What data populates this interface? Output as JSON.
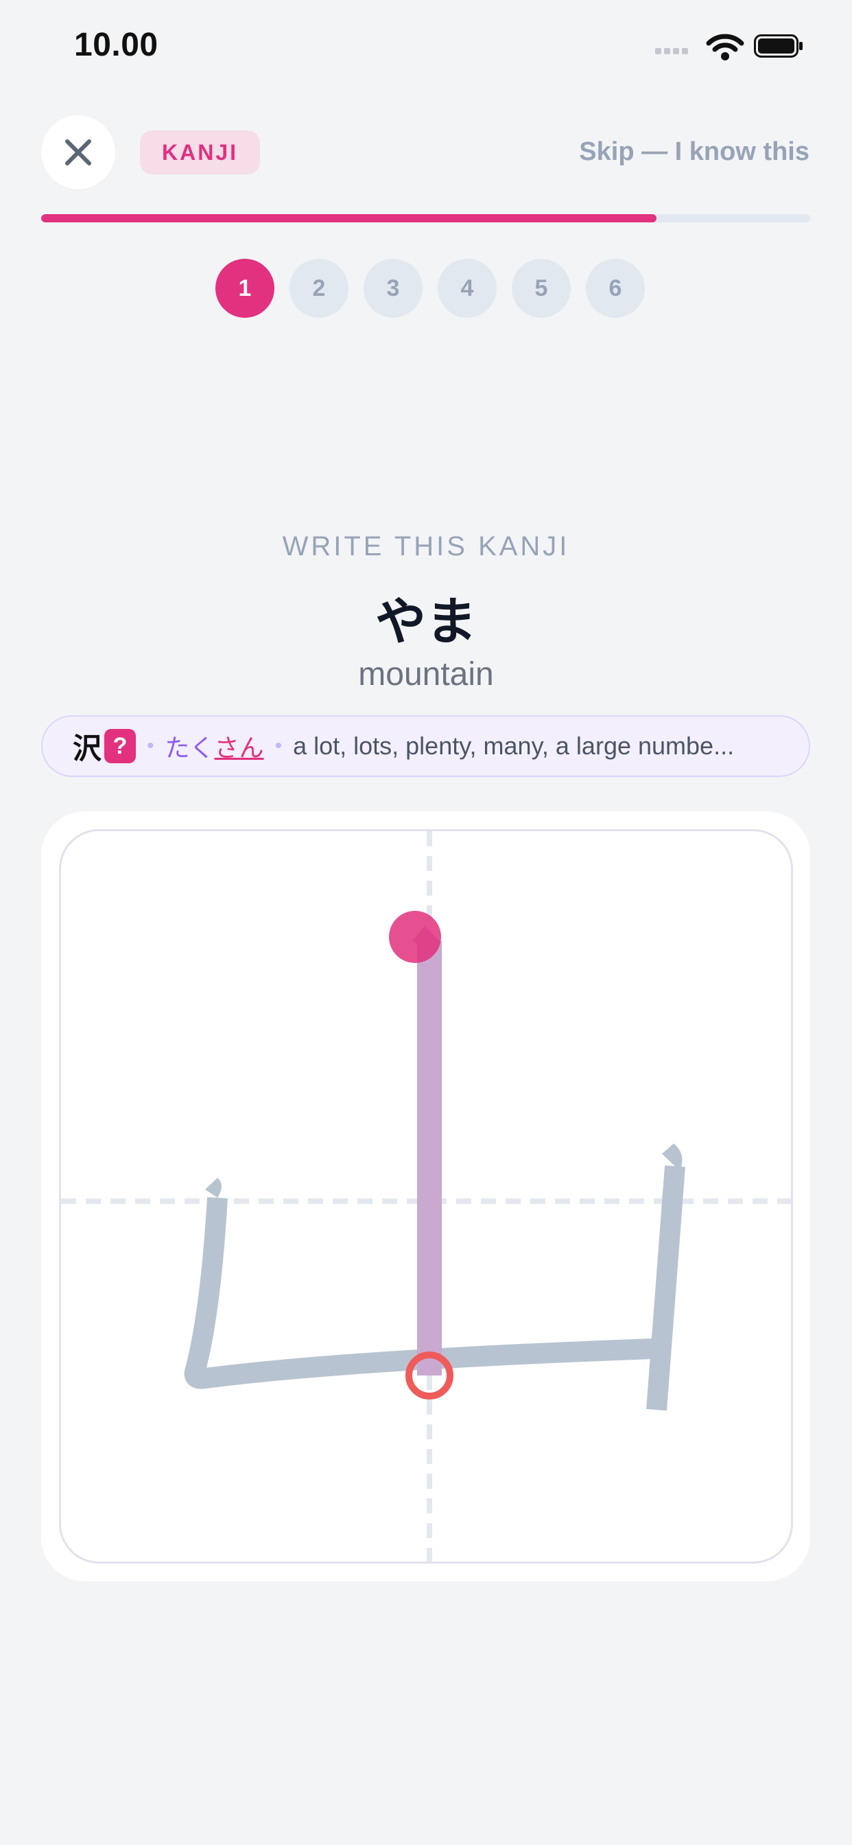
{
  "status_bar": {
    "time": "10.00"
  },
  "header": {
    "badge": "KANJI",
    "skip_label": "Skip — I know this",
    "progress": 0.8
  },
  "steps": [
    "1",
    "2",
    "3",
    "4",
    "5",
    "6"
  ],
  "active_step": 1,
  "prompt": {
    "label": "WRITE THIS KANJI",
    "kana": "やま",
    "meaning": "mountain"
  },
  "hint": {
    "kanji": "沢",
    "unknown_marker": "?",
    "reading_prefix": "たく",
    "reading_underlined": "さん",
    "definition": "a lot, lots, plenty, many, a large numbe..."
  },
  "colors": {
    "accent": "#e2317e",
    "stroke_guide": "#b8c3d1",
    "active_stroke": "#c9a9cf",
    "end_marker": "#ef5b5b"
  },
  "icons": {
    "close": "close-icon",
    "signal": "signal-icon",
    "wifi": "wifi-icon",
    "battery": "battery-icon"
  }
}
